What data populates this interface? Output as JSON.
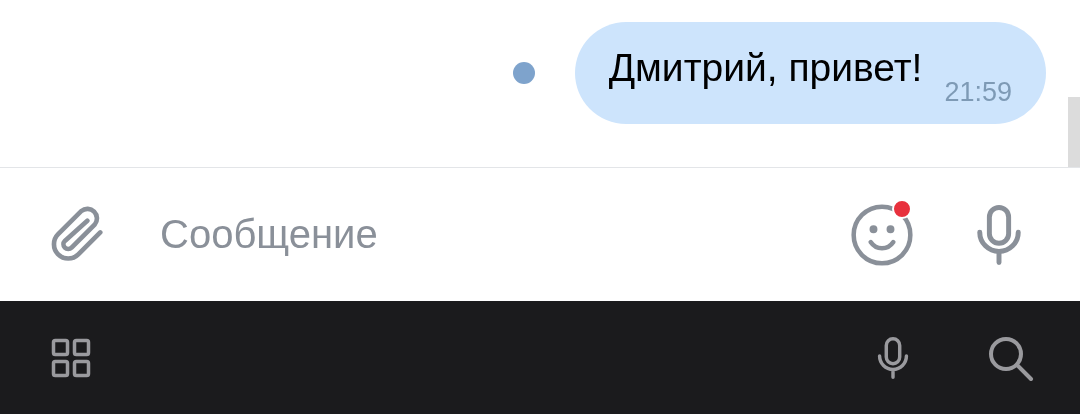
{
  "messages": [
    {
      "text": "Дмитрий, привет!",
      "time": "21:59",
      "outgoing": true,
      "unread": true
    }
  ],
  "composer": {
    "placeholder": "Сообщение",
    "emoji_badge": true
  }
}
